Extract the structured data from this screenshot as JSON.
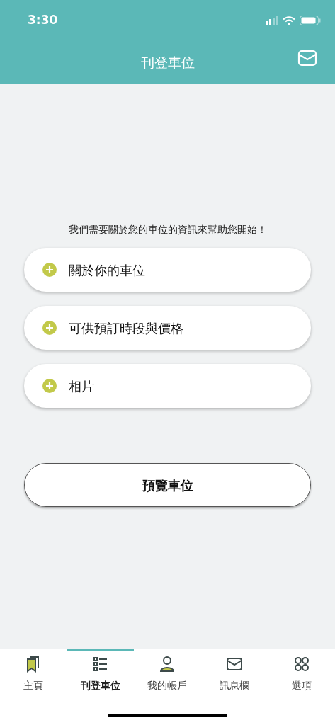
{
  "status_bar": {
    "time": "3:30"
  },
  "header": {
    "title": "刊登車位"
  },
  "intro": "我們需要關於您的車位的資訊來幫助您開始！",
  "sections": [
    {
      "label": "關於你的車位",
      "expanded": false
    },
    {
      "label": "可供預訂時段與價格",
      "expanded": false
    },
    {
      "label": "相片",
      "expanded": false
    }
  ],
  "preview_button": "預覽車位",
  "tabs": [
    {
      "label": "主頁",
      "selected": false
    },
    {
      "label": "刊登車位",
      "selected": true
    },
    {
      "label": "我的帳戶",
      "selected": false
    },
    {
      "label": "訊息欄",
      "selected": false
    },
    {
      "label": "選項",
      "selected": false
    }
  ]
}
